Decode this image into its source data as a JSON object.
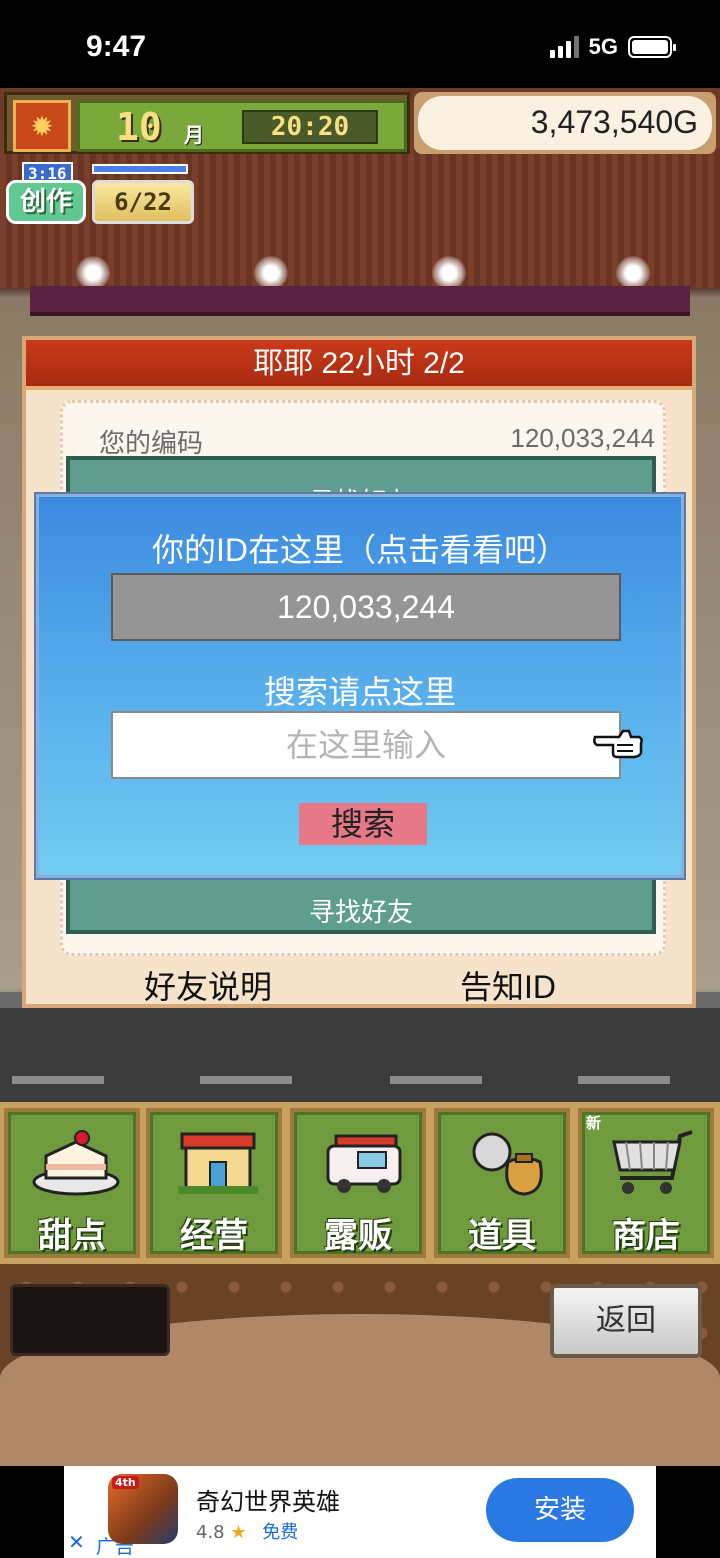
{
  "status_bar": {
    "time": "9:47",
    "network": "5G"
  },
  "hud": {
    "month": "10",
    "month_unit": "月",
    "clock": "20:20",
    "gold": "3,473,540G"
  },
  "create": {
    "timer": "3:16",
    "label": "创作",
    "count": "6/22"
  },
  "friend_panel": {
    "header": "耶耶 22小时 2/2",
    "code_label": "您的编码",
    "code_value": "120,033,244",
    "teal_top_text": "寻找好友",
    "teal_bottom_text": "寻找好友",
    "footer_left": "好友说明",
    "footer_right": "告知ID"
  },
  "dialog": {
    "title": "你的ID在这里（点击看看吧）",
    "id_value": "120,033,244",
    "search_hint": "搜索请点这里",
    "input_placeholder": "在这里输入",
    "search_button": "搜索"
  },
  "menu": {
    "items": [
      {
        "label": "甜点",
        "icon": "cake-icon"
      },
      {
        "label": "经营",
        "icon": "shop-icon"
      },
      {
        "label": "露贩",
        "icon": "food-truck-icon"
      },
      {
        "label": "道具",
        "icon": "items-bag-icon"
      },
      {
        "label": "商店",
        "icon": "cart-icon",
        "badge": "新"
      }
    ]
  },
  "back_button": "返回",
  "ad": {
    "close": "✕",
    "tag": "广告",
    "app_title": "奇幻世界英雄",
    "rating": "4.8",
    "star": "★",
    "price": "免费",
    "install": "安装",
    "icon_badge": "4th"
  }
}
